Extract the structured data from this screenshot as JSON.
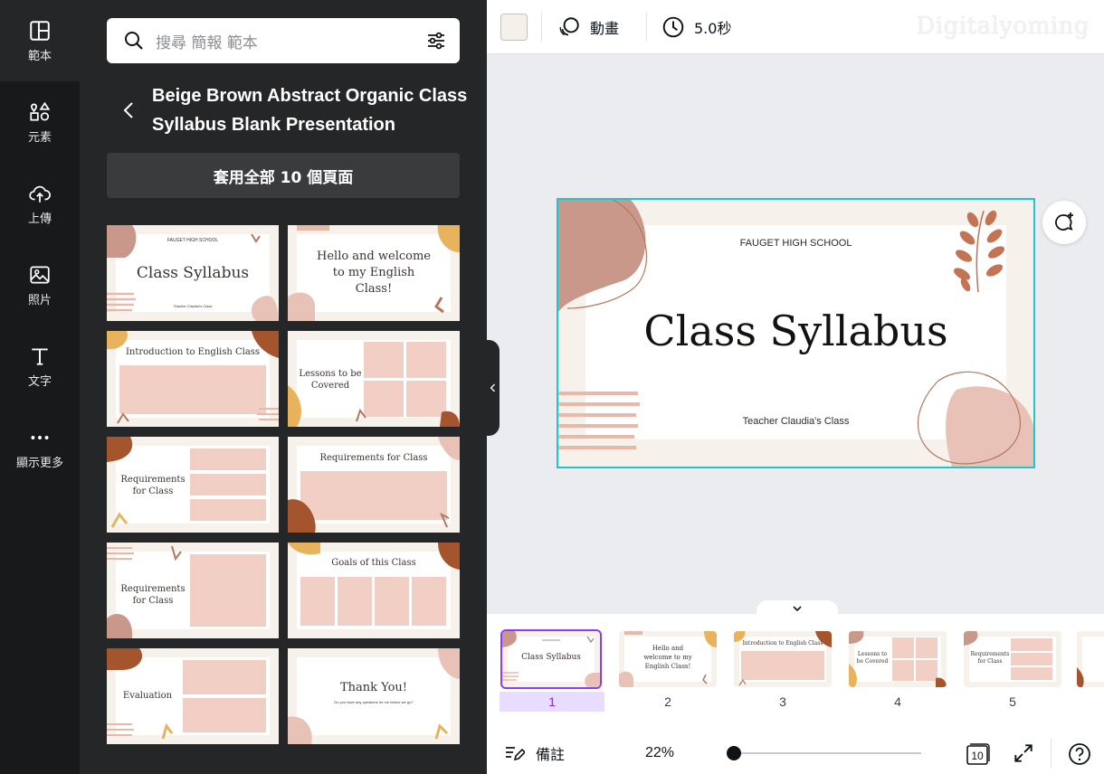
{
  "rail": {
    "items": [
      {
        "label": "範本",
        "icon": "template-icon"
      },
      {
        "label": "元素",
        "icon": "elements-icon"
      },
      {
        "label": "上傳",
        "icon": "upload-icon"
      },
      {
        "label": "照片",
        "icon": "photo-icon"
      },
      {
        "label": "文字",
        "icon": "text-icon"
      },
      {
        "label": "顯示更多",
        "icon": "more-icon"
      }
    ]
  },
  "panel": {
    "search_placeholder": "搜尋 簡報 範本",
    "template_title": "Beige Brown Abstract Organic Class Syllabus Blank Presentation",
    "apply_button": "套用全部 10 個頁面",
    "thumbs": [
      {
        "title": "Class Syllabus",
        "top": "FAUGET HIGH SCHOOL",
        "bottom": "Teacher Claudia's Class"
      },
      {
        "title": "Hello and welcome to my English Class!"
      },
      {
        "title": "Introduction to English Class"
      },
      {
        "title": "Lessons to be Covered"
      },
      {
        "title": "Requirements for Class"
      },
      {
        "title": "Requirements for Class"
      },
      {
        "title": "Requirements for Class"
      },
      {
        "title": "Goals of this Class"
      },
      {
        "title": "Evaluation"
      },
      {
        "title": "Thank You!",
        "bottom": "Do you have any questions for me before we go?"
      }
    ]
  },
  "toolbar": {
    "swatch_color": "#f4f0ea",
    "animate_label": "動畫",
    "duration_label": "5.0秒",
    "watermark": "Digitalyoming"
  },
  "slide": {
    "school": "FAUGET HIGH SCHOOL",
    "title": "Class Syllabus",
    "teacher": "Teacher Claudia's Class"
  },
  "pages": {
    "items": [
      {
        "num": "1",
        "label": "Class Syllabus"
      },
      {
        "num": "2",
        "label": "Hello and welcome to my English Class!"
      },
      {
        "num": "3",
        "label": "Introduction to English Class"
      },
      {
        "num": "4",
        "label": "Lessons to be Covered"
      },
      {
        "num": "5",
        "label": "Requirements for Class"
      }
    ],
    "selected": "1"
  },
  "bottombar": {
    "notes_label": "備註",
    "zoom": "22%",
    "page_count": "10"
  },
  "colors": {
    "accent": "#8b3dff",
    "selection": "#20c4cb",
    "blob_pink": "#e8c2b6",
    "blob_brown": "#b5765e",
    "blob_rust": "#a4552e",
    "blob_gold": "#e8b35c"
  }
}
